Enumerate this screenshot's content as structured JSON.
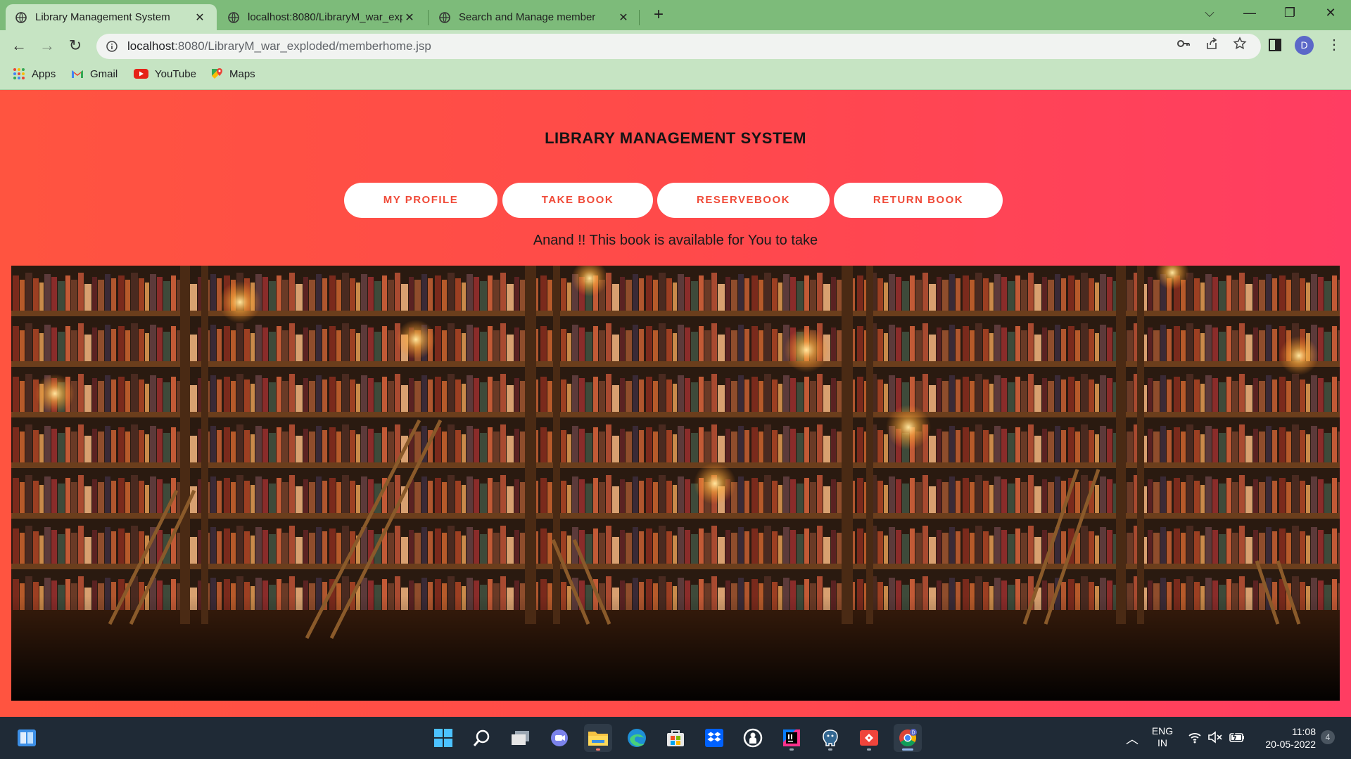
{
  "browser": {
    "tabs": [
      {
        "title": "Library Management System",
        "active": true
      },
      {
        "title": "localhost:8080/LibraryM_war_exp",
        "active": false
      },
      {
        "title": "Search and Manage member",
        "active": false
      }
    ],
    "url_host": "localhost",
    "url_rest": ":8080/LibraryM_war_exploded/memberhome.jsp",
    "avatar_letter": "D",
    "bookmarks": [
      "Apps",
      "Gmail",
      "YouTube",
      "Maps"
    ],
    "colors": {
      "tabstrip": "#7dbb7a",
      "toolbar": "#c6e4c3"
    }
  },
  "page": {
    "title": "LIBRARY MANAGEMENT SYSTEM",
    "nav": [
      "MY PROFILE",
      "TAKE BOOK",
      "RESERVEBOOK",
      "RETURN BOOK"
    ],
    "message": "Anand !! This book is available for You to take",
    "hero_image": "library bookshelves with ladders and candles",
    "colors": {
      "gradient_start": "#ff5440",
      "gradient_end": "#ff3d62",
      "button_text": "#f04a38"
    }
  },
  "taskbar": {
    "apps": [
      "start-icon",
      "search-icon",
      "task-view-icon",
      "teams-chat-icon",
      "file-explorer-icon",
      "edge-icon",
      "microsoft-store-icon",
      "dropbox-icon",
      "github-desktop-icon",
      "intellij-icon",
      "postgresql-icon",
      "anydesk-icon",
      "chrome-icon"
    ],
    "lang_line1": "ENG",
    "lang_line2": "IN",
    "time": "11:08",
    "date": "20-05-2022",
    "notification_count": "4"
  }
}
